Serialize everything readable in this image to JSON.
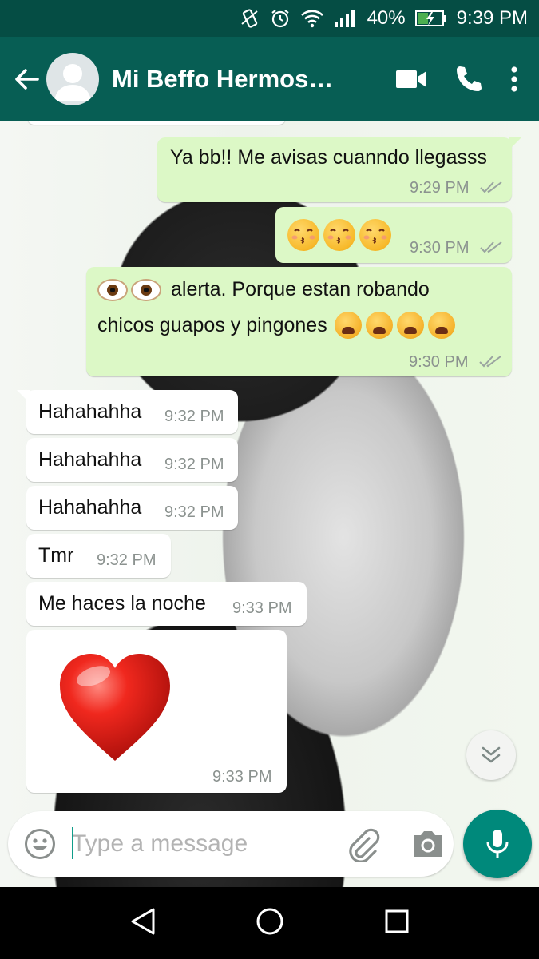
{
  "status_bar": {
    "battery": "40%",
    "time": "9:39 PM"
  },
  "header": {
    "contact_name": "Mi Beffo Hermos…"
  },
  "messages": [
    {
      "direction": "out",
      "text": "Ya bb!! Me avisas cuanndo llegasss",
      "time": "9:29 PM"
    },
    {
      "direction": "out",
      "emojis": [
        "kissing-face-smiling-eyes",
        "kissing-face-smiling-eyes",
        "kissing-face-smiling-eyes"
      ],
      "time": "9:30 PM"
    },
    {
      "direction": "out",
      "line1_text": "alerta. Porque estan robando",
      "line2_text": "chicos guapos y pingones",
      "time": "9:30 PM"
    },
    {
      "direction": "in",
      "text": "Hahahahha",
      "time": "9:32 PM"
    },
    {
      "direction": "in",
      "text": "Hahahahha",
      "time": "9:32 PM"
    },
    {
      "direction": "in",
      "text": "Hahahahha",
      "time": "9:32 PM"
    },
    {
      "direction": "in",
      "text": "Tmr",
      "time": "9:32 PM"
    },
    {
      "direction": "in",
      "text": "Me haces la noche",
      "time": "9:33 PM"
    },
    {
      "direction": "in",
      "emojis": [
        "red-heart"
      ],
      "time": "9:33 PM"
    }
  ],
  "composer": {
    "placeholder": "Type a message"
  },
  "colors": {
    "header": "#075e54",
    "status_bar": "#054d44",
    "outgoing_bubble": "#dcf8c6",
    "incoming_bubble": "#ffffff",
    "accent": "#00897b",
    "read_ticks": "#9aa4a0"
  }
}
